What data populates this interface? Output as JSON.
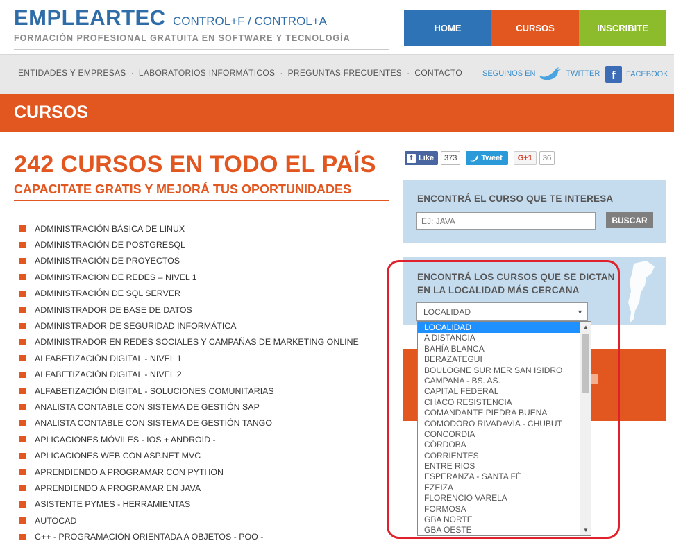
{
  "brand": {
    "name": "EMPLEARTEC",
    "tagline": "CONTROL+F / CONTROL+A",
    "subtitle": "FORMACIÓN PROFESIONAL GRATUITA EN SOFTWARE Y TECNOLOGÍA"
  },
  "top_nav": [
    {
      "label": "HOME"
    },
    {
      "label": "CURSOS"
    },
    {
      "label": "INSCRIBITE"
    }
  ],
  "sub_nav": {
    "links": [
      "ENTIDADES Y EMPRESAS",
      "LABORATORIOS INFORMÁTICOS",
      "PREGUNTAS FRECUENTES",
      "CONTACTO"
    ],
    "separator": "·",
    "twitter_prefix": "SEGUINOS EN",
    "twitter_label": "TWITTER",
    "facebook_label": "FACEBOOK",
    "facebook_letter": "f"
  },
  "banner": {
    "title": "CURSOS"
  },
  "main": {
    "headline": "242 CURSOS EN TODO EL PAÍS",
    "subheadline": "CAPACITATE GRATIS Y MEJORÁ TUS OPORTUNIDADES",
    "courses": [
      "ADMINISTRACIÓN BÁSICA DE LINUX",
      "ADMINISTRACIÓN DE POSTGRESQL",
      "ADMINISTRACIÓN DE PROYECTOS",
      "ADMINISTRACION DE REDES – NIVEL 1",
      "ADMINISTRACIÓN DE SQL SERVER",
      "ADMINISTRADOR DE BASE DE DATOS",
      "ADMINISTRADOR DE SEGURIDAD INFORMÁTICA",
      "ADMINISTRADOR EN REDES SOCIALES Y CAMPAÑAS DE MARKETING ONLINE",
      "ALFABETIZACIÓN DIGITAL - NIVEL 1",
      "ALFABETIZACIÓN DIGITAL - NIVEL 2",
      "ALFABETIZACIÓN DIGITAL - SOLUCIONES COMUNITARIAS",
      "ANALISTA CONTABLE CON SISTEMA DE GESTIÓN SAP",
      "ANALISTA CONTABLE CON SISTEMA DE GESTIÓN TANGO",
      "APLICACIONES MÓVILES - IOS + ANDROID -",
      "APLICACIONES WEB CON ASP.NET MVC",
      "APRENDIENDO A PROGRAMAR CON PYTHON",
      "APRENDIENDO A PROGRAMAR EN JAVA",
      "ASISTENTE PYMES - HERRAMIENTAS",
      "AUTOCAD",
      "C++ - PROGRAMACIÓN ORIENTADA A OBJETOS - POO -"
    ]
  },
  "share": {
    "like_label": "Like",
    "like_letter": "f",
    "like_count": "373",
    "tweet_label": "Tweet",
    "gplus_label": "G+1",
    "gplus_count": "36"
  },
  "search_panel": {
    "title": "ENCONTRÁ EL CURSO QUE TE INTERESA",
    "placeholder": "EJ: JAVA",
    "button_label": "BUSCAR"
  },
  "location_panel": {
    "title": "ENCONTRÁ LOS CURSOS QUE SE DICTAN EN LA LOCALIDAD MÁS CERCANA",
    "selected": "LOCALIDAD",
    "options": [
      "LOCALIDAD",
      "A DISTANCIA",
      "BAHÍA BLANCA",
      "BERAZATEGUI",
      "BOULOGNE SUR MER SAN ISIDRO",
      "CAMPANA - BS. AS.",
      "CAPITAL FEDERAL",
      "CHACO RESISTENCIA",
      "COMANDANTE PIEDRA BUENA",
      "COMODORO RIVADAVIA - CHUBUT",
      "CONCORDIA",
      "CÓRDOBA",
      "CORRIENTES",
      "ENTRE RIOS",
      "ESPERANZA - SANTA FÉ",
      "EZEIZA",
      "FLORENCIO VARELA",
      "FORMOSA",
      "GBA NORTE",
      "GBA OESTE"
    ]
  },
  "colors": {
    "brand_blue": "#2f6da8",
    "accent_orange": "#e2561f",
    "accent_green": "#8cbb2c",
    "panel_blue": "#c5dbee",
    "highlight_red": "#e0202a",
    "selected_option": "#1e90ff"
  }
}
